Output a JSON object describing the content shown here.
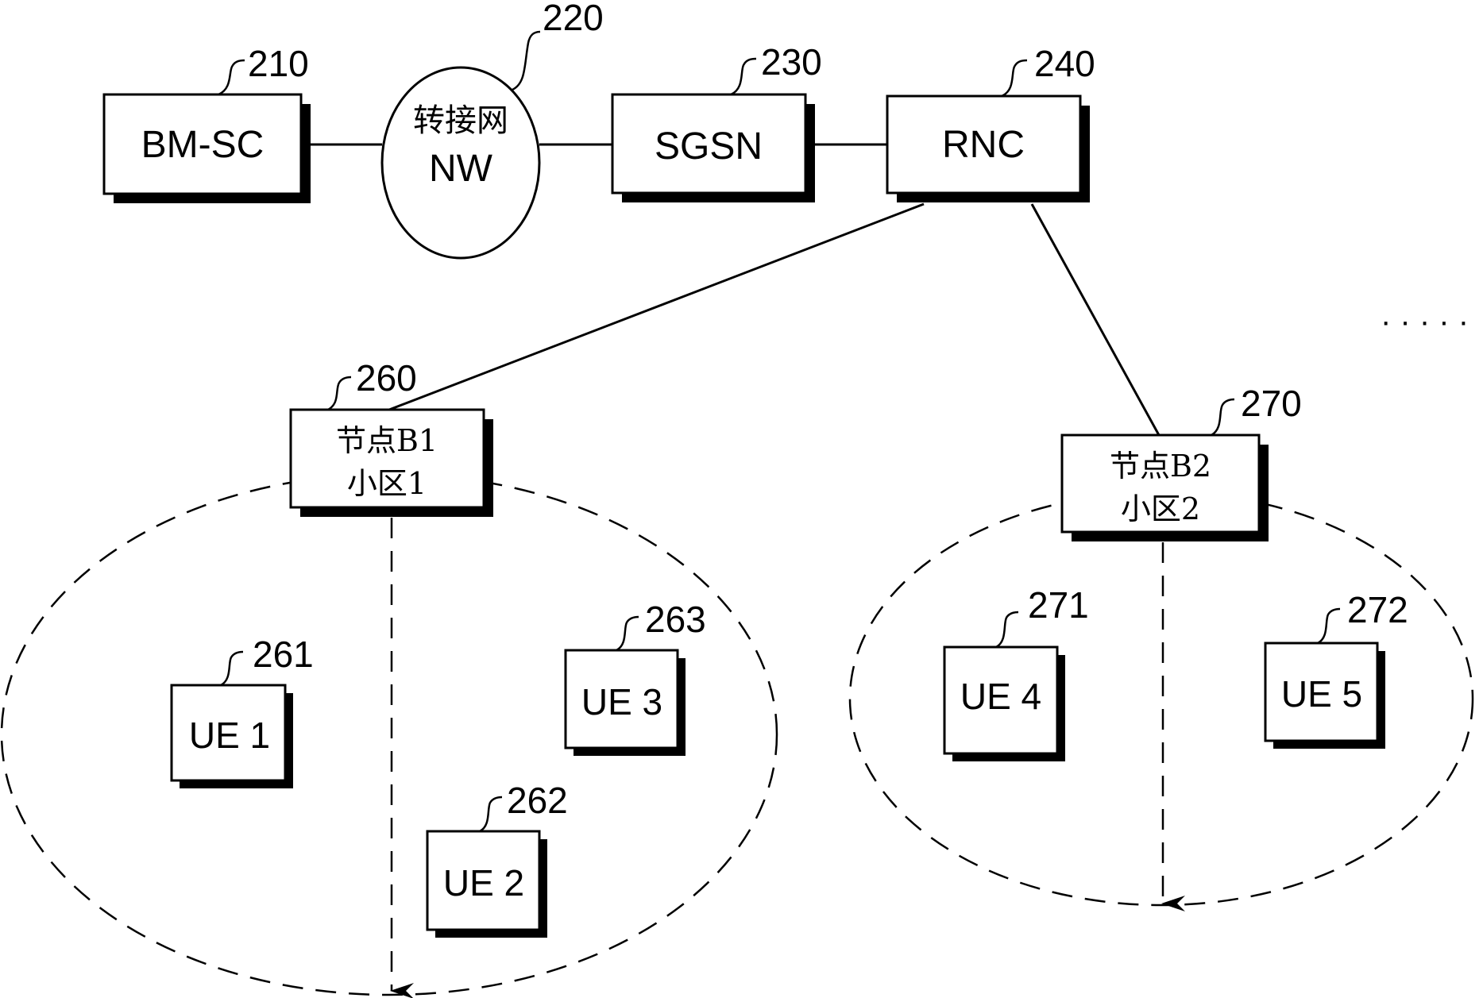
{
  "figure": {
    "nodes": {
      "bmsc": {
        "label": "BM-SC",
        "ref": "210"
      },
      "nw": {
        "label_cjk": "转接网",
        "label": "NW",
        "ref": "220"
      },
      "sgsn": {
        "label": "SGSN",
        "ref": "230"
      },
      "rnc": {
        "label": "RNC",
        "ref": "240"
      },
      "nodeb1": {
        "line1": "节点B1",
        "line2": "小区1",
        "ref": "260"
      },
      "nodeb2": {
        "line1": "节点B2",
        "line2": "小区2",
        "ref": "270"
      },
      "ue1": {
        "label": "UE 1",
        "ref": "261"
      },
      "ue2": {
        "label": "UE 2",
        "ref": "262"
      },
      "ue3": {
        "label": "UE 3",
        "ref": "263"
      },
      "ue4": {
        "label": "UE 4",
        "ref": "271"
      },
      "ue5": {
        "label": "UE 5",
        "ref": "272"
      }
    },
    "continuation": "· · · · ·",
    "connections": [
      [
        "bmsc",
        "nw"
      ],
      [
        "nw",
        "sgsn"
      ],
      [
        "sgsn",
        "rnc"
      ],
      [
        "rnc",
        "nodeb1"
      ],
      [
        "rnc",
        "nodeb2"
      ]
    ],
    "cells": [
      {
        "id": "cell-1",
        "base_station": "nodeb1",
        "members": [
          "ue1",
          "ue2",
          "ue3"
        ]
      },
      {
        "id": "cell-2",
        "base_station": "nodeb2",
        "members": [
          "ue4",
          "ue5"
        ]
      }
    ]
  }
}
